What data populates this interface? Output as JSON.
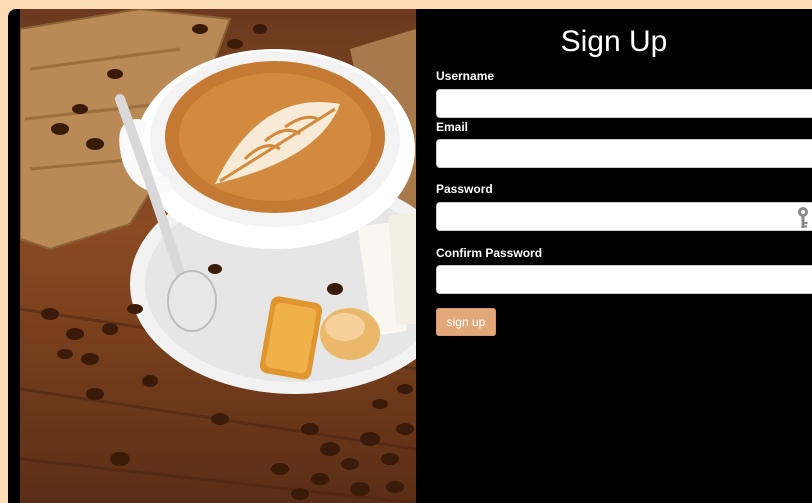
{
  "form": {
    "title": "Sign Up",
    "username_label": "Username",
    "username_value": "",
    "email_label": "Email",
    "email_value": "",
    "password_label": "Password",
    "password_value": "",
    "confirm_label": "Confirm Password",
    "confirm_value": "",
    "submit_label": "sign up"
  },
  "colors": {
    "page_background": "#fddcb5",
    "panel_background": "#000000",
    "button_accent": "#e2a878"
  },
  "icons": {
    "password_field_icon": "key-icon",
    "photo": "coffee-cup-photo"
  }
}
